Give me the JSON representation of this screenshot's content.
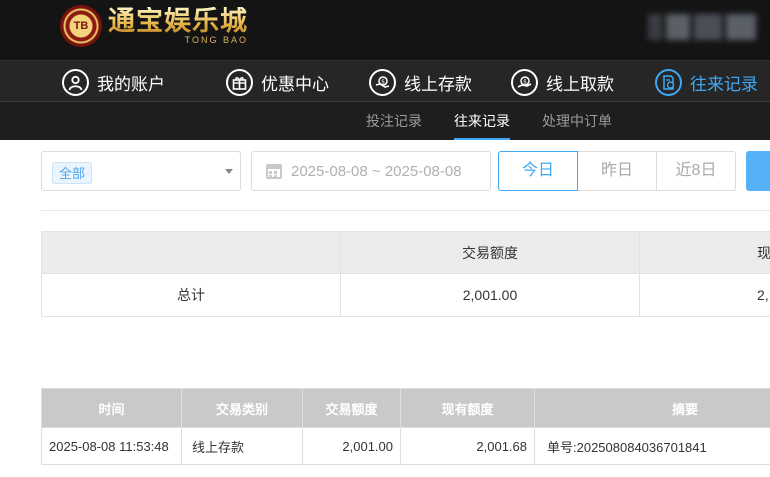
{
  "brand": {
    "logo_badge": "TB",
    "name_cn": "通宝娱乐城",
    "name_en": "TONG BAO"
  },
  "nav": {
    "items": [
      {
        "label": "我的账户",
        "icon": "user-icon"
      },
      {
        "label": "优惠中心",
        "icon": "gift-icon"
      },
      {
        "label": "线上存款",
        "icon": "deposit-icon"
      },
      {
        "label": "线上取款",
        "icon": "withdraw-icon"
      },
      {
        "label": "往来记录",
        "icon": "records-icon",
        "active": true
      }
    ]
  },
  "subnav": {
    "items": [
      {
        "label": "投注记录"
      },
      {
        "label": "往来记录",
        "active": true
      },
      {
        "label": "处理中订单"
      }
    ]
  },
  "filters": {
    "type_selected": "全部",
    "date_range": "2025-08-08 ~ 2025-08-08",
    "quick": [
      "今日",
      "昨日",
      "近8日"
    ],
    "quick_active": "今日"
  },
  "summary": {
    "headers": [
      "",
      "交易额度",
      "现"
    ],
    "row_label": "总计",
    "values": [
      "2,001.00",
      "2,"
    ]
  },
  "records": {
    "headers": [
      "时间",
      "交易类别",
      "交易额度",
      "现有额度",
      "摘要"
    ],
    "rows": [
      [
        "2025-08-08 11:53:48",
        "线上存款",
        "2,001.00",
        "2,001.68",
        "单号:202508084036701841"
      ]
    ]
  },
  "colors": {
    "accent": "#3fa8f5",
    "header_bg": "#141414",
    "nav_bg": "#262626",
    "subnav_bg": "#1e1e1e",
    "table_header_bg": "#c9c9c9"
  }
}
